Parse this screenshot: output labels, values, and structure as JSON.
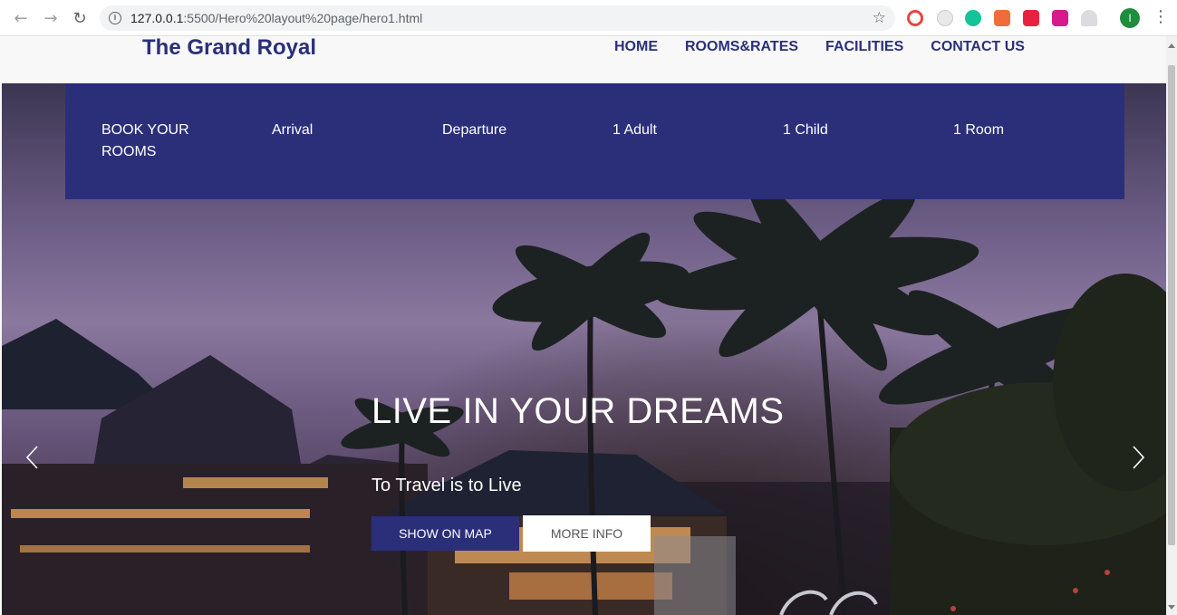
{
  "browser": {
    "url_host": "127.0.0.1",
    "url_path": ":5500/Hero%20layout%20page/hero1.html",
    "avatar_letter": "I"
  },
  "header": {
    "brand": "The Grand Royal",
    "nav": [
      "HOME",
      "ROOMS&RATES",
      "FACILITIES",
      "CONTACT US"
    ]
  },
  "booking": {
    "items": [
      "BOOK YOUR ROOMS",
      "Arrival",
      "Departure",
      "1 Adult",
      "1 Child",
      "1 Room"
    ]
  },
  "hero": {
    "title": "LIVE IN YOUR DREAMS",
    "subtitle": "To Travel is to Live",
    "primary_button": "SHOW ON MAP",
    "secondary_button": "MORE INFO"
  },
  "colors": {
    "brand": "#2b2f7a",
    "white": "#ffffff"
  },
  "icons": {
    "back": "arrow-left-icon",
    "forward": "arrow-right-icon",
    "reload": "reload-icon",
    "bookmark": "star-icon",
    "menu": "more-vert-icon",
    "carousel_prev": "chevron-left-icon",
    "carousel_next": "chevron-right-icon"
  }
}
